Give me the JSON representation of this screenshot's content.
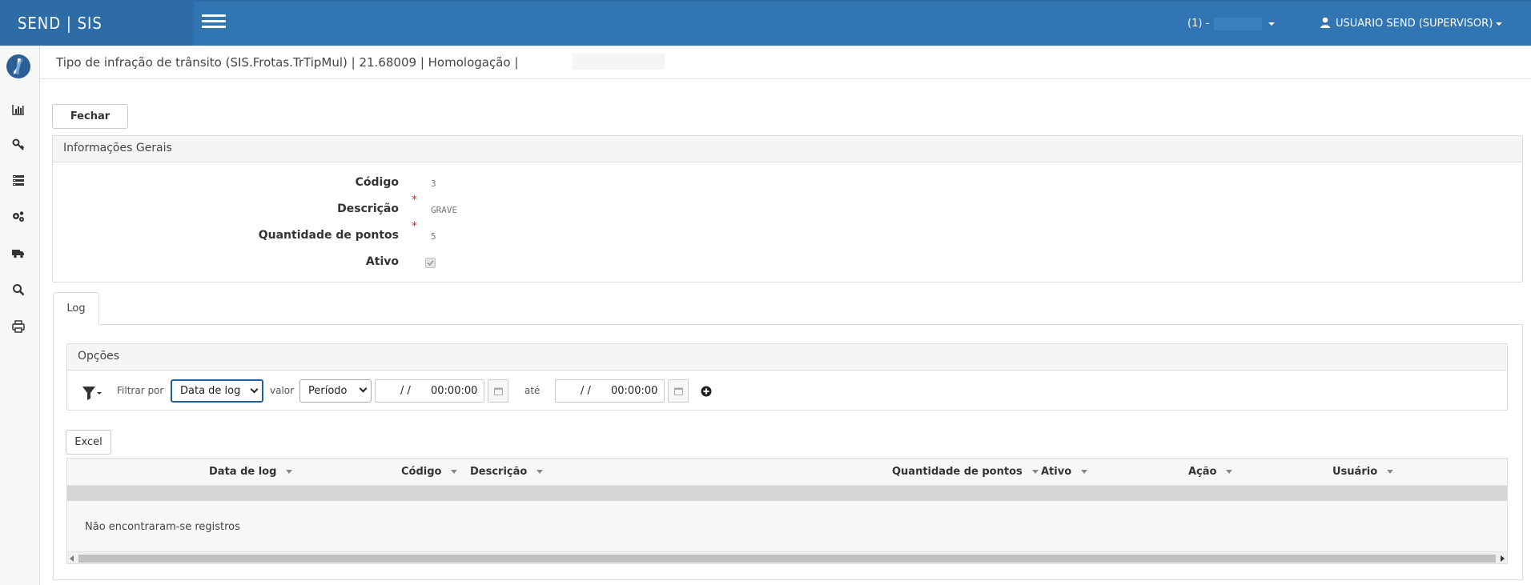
{
  "topbar": {
    "brand": "SEND | SIS",
    "company_label": "(1) -",
    "user_label": "USUARIO SEND (SUPERVISOR)"
  },
  "sidebar": {
    "items": [
      "chart-icon",
      "key-icon",
      "list-icon",
      "gears-icon",
      "truck-icon",
      "search-icon",
      "print-icon"
    ]
  },
  "page": {
    "title": "Tipo de infração de trânsito (SIS.Frotas.TrTipMul) | 21.68009 | Homologação |"
  },
  "actions": {
    "close_label": "Fechar"
  },
  "general_info": {
    "header": "Informações Gerais",
    "fields": [
      {
        "label": "Código",
        "value": "3"
      },
      {
        "label": "Descrição",
        "value": "GRAVE"
      },
      {
        "label": "Quantidade de pontos",
        "value": "5"
      },
      {
        "label": "Ativo",
        "value": ""
      }
    ],
    "ativo_checked": true
  },
  "tabs": [
    {
      "label": "Log"
    }
  ],
  "options": {
    "header": "Opções",
    "filter_by_label": "Filtrar por",
    "filter_field": "Data de log",
    "value_label": "valor",
    "value_mode": "Período",
    "from_date": "/ /",
    "from_time": "00:00:00",
    "until_label": "até",
    "to_date": "/ /",
    "to_time": "00:00:00"
  },
  "log_table": {
    "excel_label": "Excel",
    "columns": [
      "Data de log",
      "Código",
      "Descrição",
      "Quantidade de pontos",
      "Ativo",
      "Ação",
      "Usuário"
    ],
    "empty_message": "Não encontraram-se registros"
  }
}
